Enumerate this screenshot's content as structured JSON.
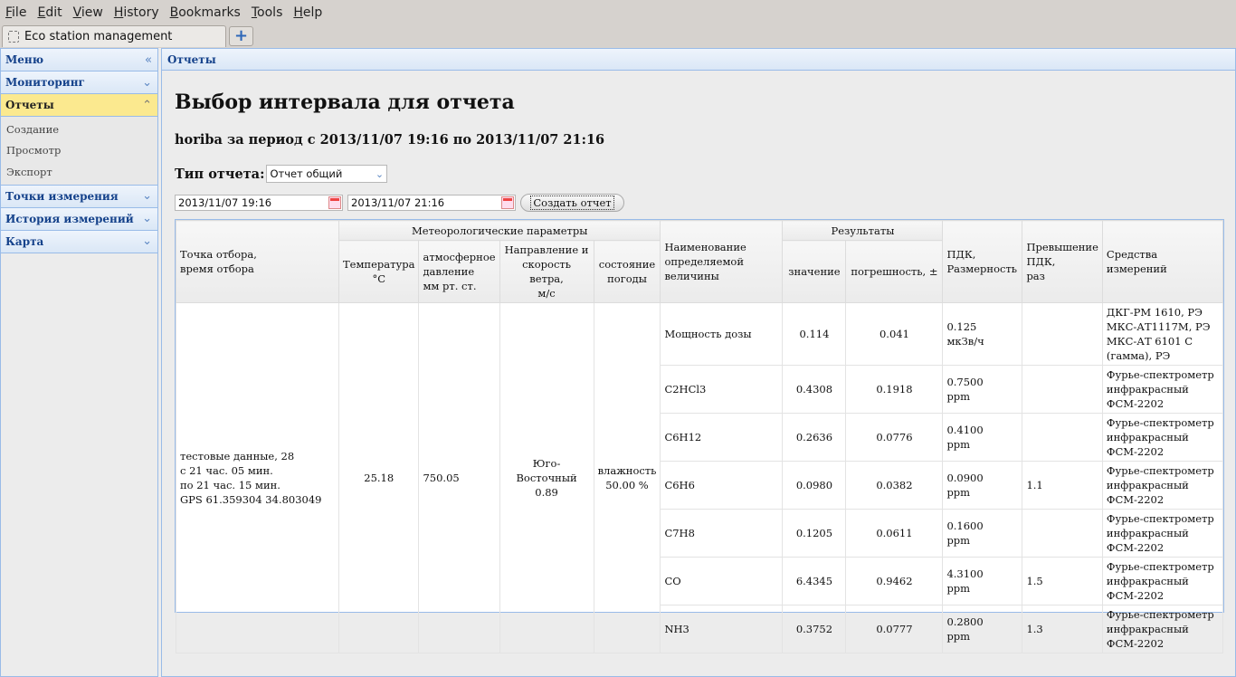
{
  "menubar": {
    "items": [
      "File",
      "Edit",
      "View",
      "History",
      "Bookmarks",
      "Tools",
      "Help"
    ]
  },
  "tab": {
    "title": "Eco station management"
  },
  "sidebar": {
    "menu_title": "Меню",
    "sections": [
      {
        "label": "Мониторинг"
      },
      {
        "label": "Отчеты"
      },
      {
        "label": "Точки измерения"
      },
      {
        "label": "История измерений"
      },
      {
        "label": "Карта"
      }
    ],
    "reports_items": [
      "Создание",
      "Просмотр",
      "Экспорт"
    ]
  },
  "main": {
    "header": "Отчеты",
    "title": "Выбор интервала для отчета",
    "subtitle": "horiba за период с 2013/11/07 19:16 по 2013/11/07 21:16",
    "report_type_label": "Тип отчета:",
    "report_type_value": "Отчет общий",
    "date_from": "2013/11/07 19:16",
    "date_to": "2013/11/07 21:16",
    "create_button": "Создать отчет"
  },
  "table": {
    "headers": {
      "point": [
        "Точка отбора,",
        "время отбора"
      ],
      "meteo": "Метеорологические параметры",
      "temp": [
        "Температура",
        "°С"
      ],
      "pressure": [
        "атмосферное",
        "давление",
        "мм рт. ст."
      ],
      "wind": [
        "Направление и",
        "скорость ветра,",
        "м/с"
      ],
      "weather": [
        "состояние",
        "погоды"
      ],
      "name": [
        "Наименование",
        "определяемой",
        "величины"
      ],
      "results": "Результаты",
      "value": "значение",
      "error": "погрешность, ±",
      "pdk": [
        "ПДК,",
        "Размерность"
      ],
      "excess": [
        "Превышение",
        "ПДК,",
        "раз"
      ],
      "instruments": "Средства измерений"
    },
    "point_lines": [
      "тестовые данные, 28",
      "с 21 час. 05 мин.",
      "по 21 час. 15 мин.",
      "GPS 61.359304 34.803049"
    ],
    "temperature": "25.18",
    "pressure": "750.05",
    "wind": [
      "Юго-Восточный",
      "0.89"
    ],
    "weather": [
      "влажность",
      "50.00 %"
    ],
    "rows": [
      {
        "name": "Мощность дозы",
        "value": "0.114",
        "error": "0.041",
        "pdk": [
          "0.125",
          "мкЗв/ч"
        ],
        "excess": "",
        "instr": [
          "ДКГ-РМ 1610, РЭ",
          "МКС-АТ1117М, РЭ",
          "МКС-АТ 6101 С",
          "(гамма), РЭ"
        ]
      },
      {
        "name": "C2HCl3",
        "value": "0.4308",
        "error": "0.1918",
        "pdk": [
          "0.7500",
          "ppm"
        ],
        "excess": "",
        "instr": [
          "Фурье-спектрометр",
          "инфракрасный",
          "ФСМ-2202"
        ]
      },
      {
        "name": "C6H12",
        "value": "0.2636",
        "error": "0.0776",
        "pdk": [
          "0.4100",
          "ppm"
        ],
        "excess": "",
        "instr": [
          "Фурье-спектрометр",
          "инфракрасный",
          "ФСМ-2202"
        ]
      },
      {
        "name": "C6H6",
        "value": "0.0980",
        "error": "0.0382",
        "pdk": [
          "0.0900",
          "ppm"
        ],
        "excess": "1.1",
        "instr": [
          "Фурье-спектрометр",
          "инфракрасный",
          "ФСМ-2202"
        ]
      },
      {
        "name": "C7H8",
        "value": "0.1205",
        "error": "0.0611",
        "pdk": [
          "0.1600",
          "ppm"
        ],
        "excess": "",
        "instr": [
          "Фурье-спектрометр",
          "инфракрасный",
          "ФСМ-2202"
        ]
      },
      {
        "name": "CO",
        "value": "6.4345",
        "error": "0.9462",
        "pdk": [
          "4.3100",
          "ppm"
        ],
        "excess": "1.5",
        "instr": [
          "Фурье-спектрометр",
          "инфракрасный",
          "ФСМ-2202"
        ]
      },
      {
        "name": "NH3",
        "value": "0.3752",
        "error": "0.0777",
        "pdk": [
          "0.2800",
          "ppm"
        ],
        "excess": "1.3",
        "instr": [
          "Фурье-спектрометр",
          "инфракрасный",
          "ФСМ-2202"
        ]
      }
    ]
  }
}
